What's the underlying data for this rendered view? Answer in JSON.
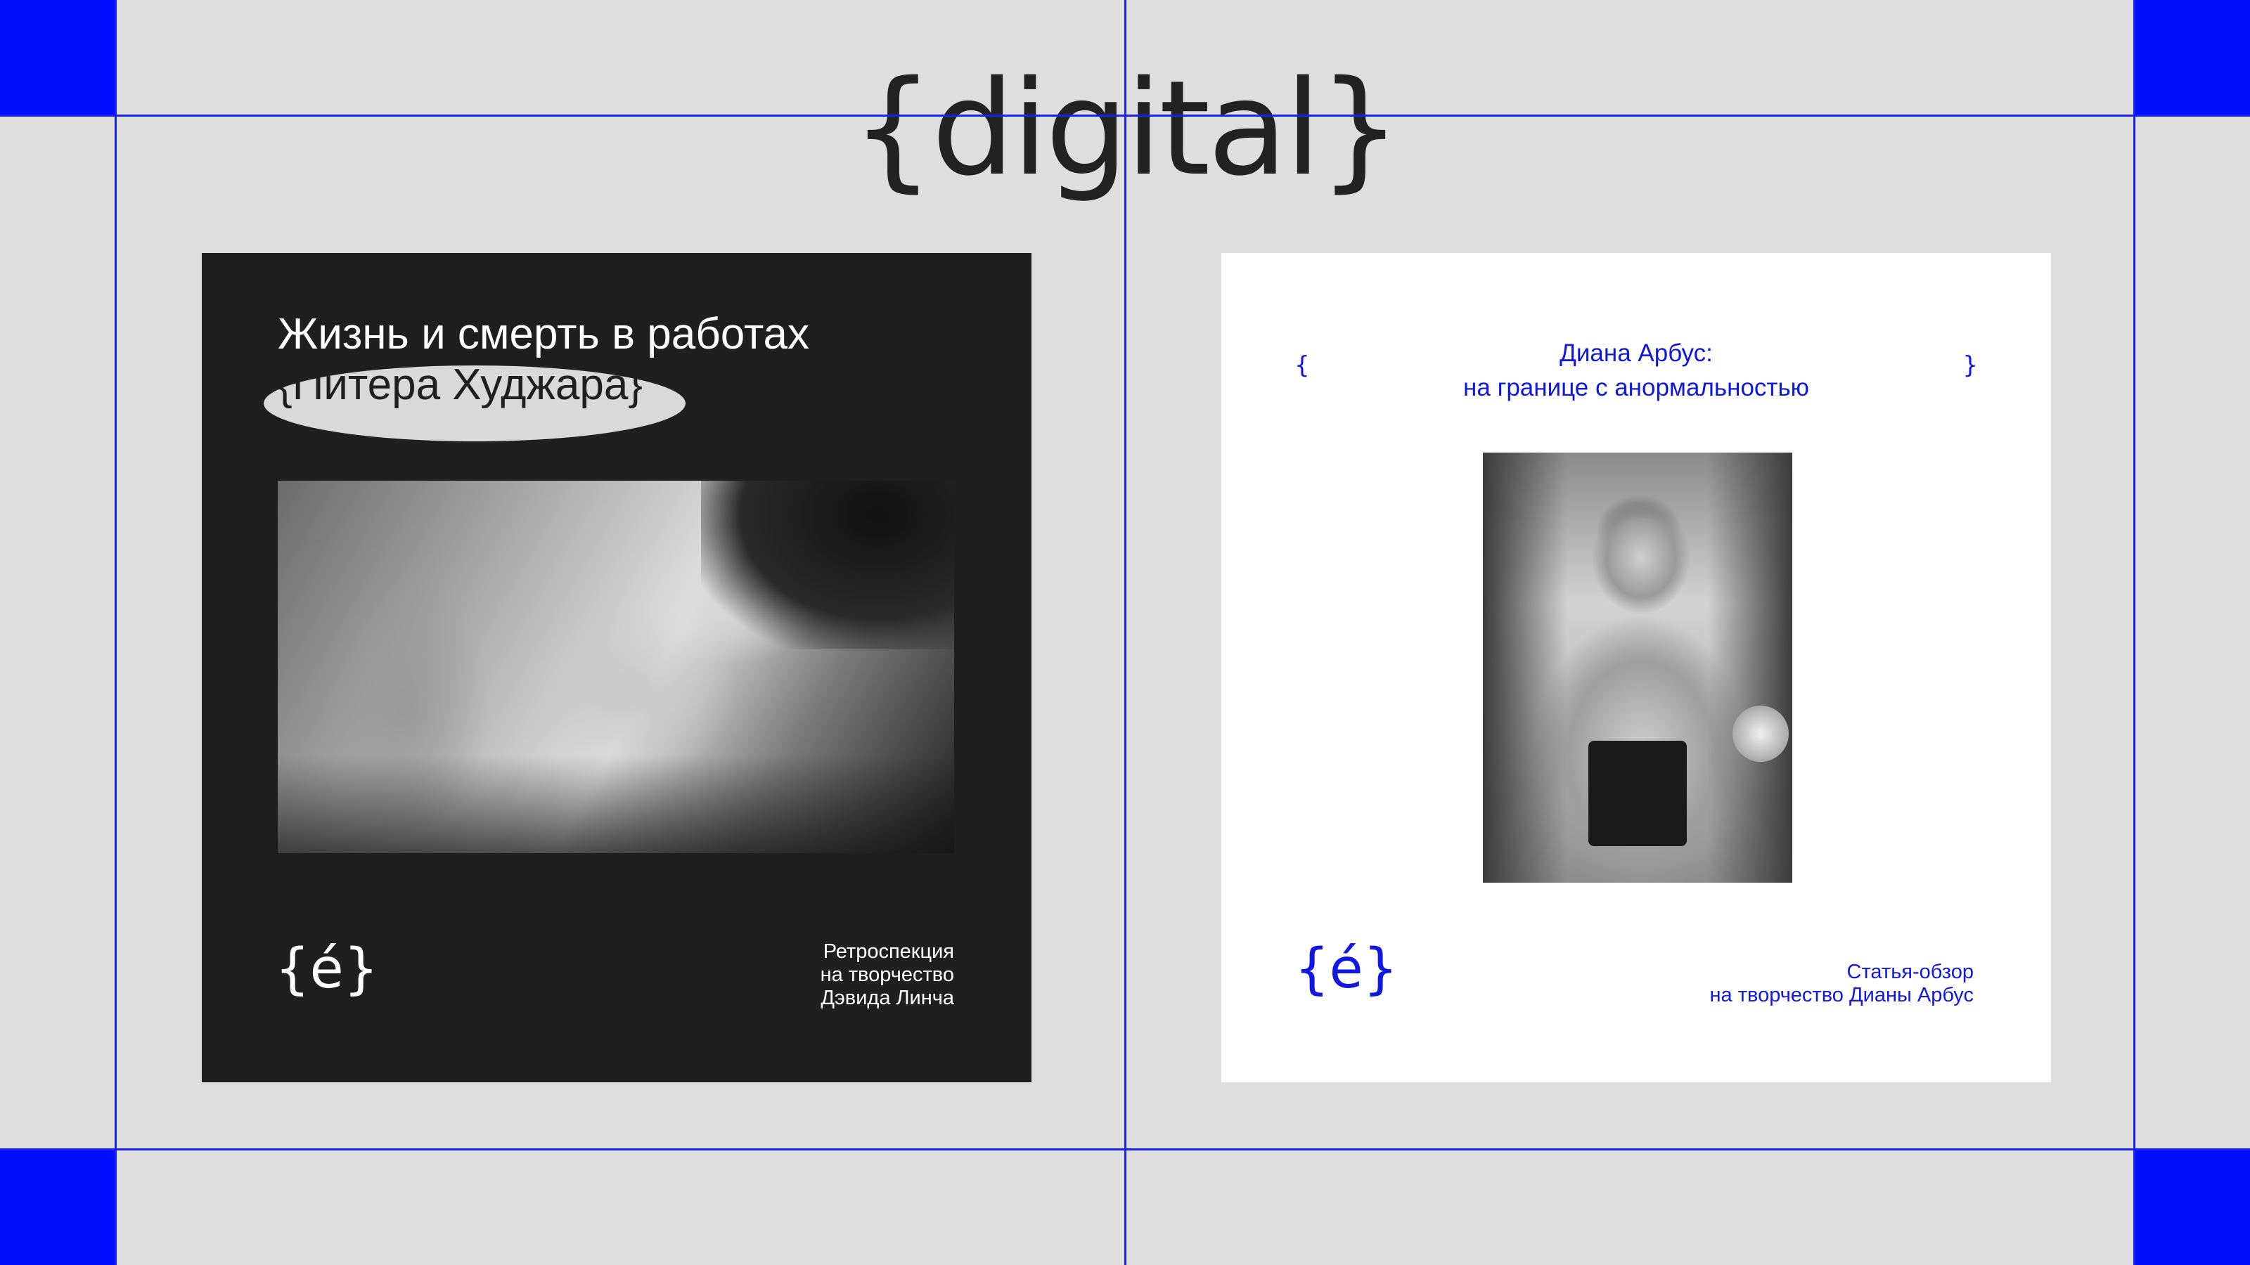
{
  "wordmark": "{digital}",
  "colors": {
    "accent": "#0010ff",
    "background": "#dedede",
    "dark_card": "#1f1f1f",
    "light_card": "#ffffff"
  },
  "dark_card": {
    "title_line1": "Жизнь и смерть в работах",
    "title_line2": "{Питера Худжара}",
    "logo": "{é}",
    "caption": [
      "Ретроспекция",
      "на творчество",
      "Дэвида Линча"
    ]
  },
  "light_card": {
    "bracket_open": "{",
    "bracket_close": "}",
    "title_line1": "Диана Арбус:",
    "title_line2": "на границе с анормальностью",
    "logo": "{é}",
    "caption": [
      "Статья-обзор",
      "на творчество Дианы Арбус"
    ]
  }
}
